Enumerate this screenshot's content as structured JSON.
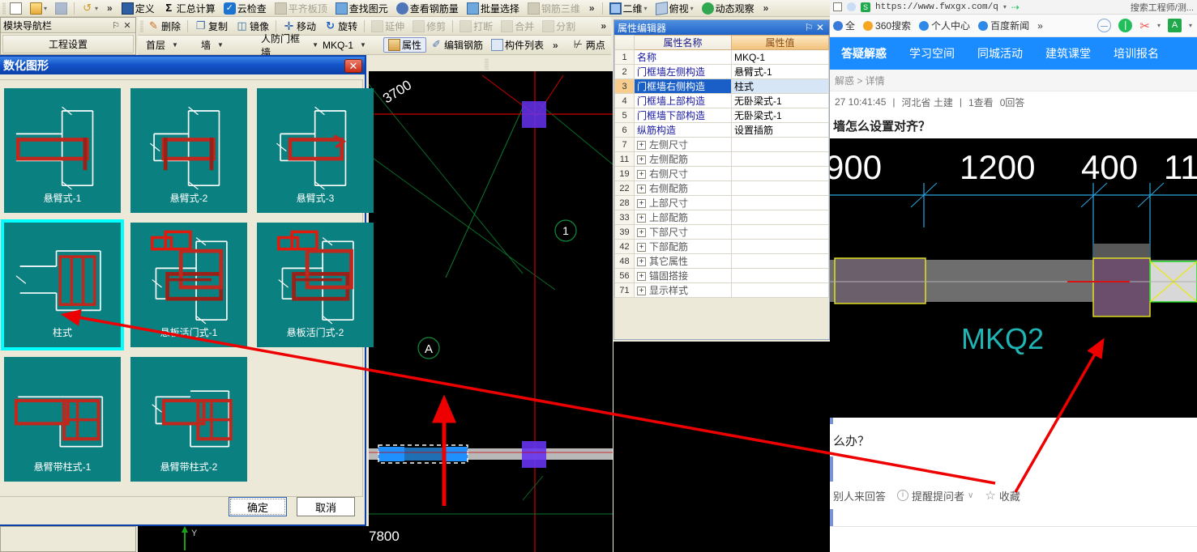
{
  "app": {
    "toolbar_row1": [
      {
        "label": "",
        "icon": "new-document-icon",
        "disabled": false
      },
      {
        "label": "",
        "icon": "open-folder-icon",
        "disabled": false
      },
      {
        "label": "",
        "icon": "save-icon",
        "disabled": true
      },
      {
        "label": "",
        "icon": "undo-icon",
        "disabled": true
      },
      {
        "label": "定义",
        "icon": "define-icon",
        "disabled": false
      },
      {
        "label": "汇总计算",
        "icon": "sigma-icon",
        "disabled": false
      },
      {
        "label": "云检查",
        "icon": "cloud-check-icon",
        "disabled": false
      },
      {
        "label": "平齐板顶",
        "icon": "align-slab-icon",
        "disabled": true
      },
      {
        "label": "查找图元",
        "icon": "binoculars-icon",
        "disabled": false
      },
      {
        "label": "查看钢筋量",
        "icon": "view-rebar-icon",
        "disabled": false
      },
      {
        "label": "批量选择",
        "icon": "batch-select-icon",
        "disabled": false
      },
      {
        "label": "钢筋三维",
        "icon": "rebar-3d-icon",
        "disabled": true
      },
      {
        "label": "二维",
        "icon": "view-2d-icon",
        "disabled": false
      },
      {
        "label": "俯视",
        "icon": "top-view-icon",
        "disabled": false
      },
      {
        "label": "动态观察",
        "icon": "dynamic-observe-icon",
        "disabled": false
      }
    ],
    "toolbar_row2": [
      {
        "label": "删除",
        "icon": "delete-icon",
        "disabled": false
      },
      {
        "label": "复制",
        "icon": "copy-icon",
        "disabled": false
      },
      {
        "label": "镜像",
        "icon": "mirror-icon",
        "disabled": false
      },
      {
        "label": "移动",
        "icon": "move-icon",
        "disabled": false
      },
      {
        "label": "旋转",
        "icon": "rotate-icon",
        "disabled": false
      },
      {
        "label": "延伸",
        "icon": "extend-icon",
        "disabled": true
      },
      {
        "label": "修剪",
        "icon": "trim-icon",
        "disabled": true
      },
      {
        "label": "打断",
        "icon": "break-icon",
        "disabled": true
      },
      {
        "label": "合并",
        "icon": "merge-icon",
        "disabled": true
      },
      {
        "label": "分割",
        "icon": "split-icon",
        "disabled": true
      }
    ],
    "toolbar_row3": [
      {
        "label": "属性",
        "icon": "property-icon",
        "selected": true
      },
      {
        "label": "编辑钢筋",
        "icon": "edit-rebar-icon",
        "selected": false
      },
      {
        "label": "构件列表",
        "icon": "component-list-icon",
        "selected": false
      },
      {
        "label": "两点",
        "icon": "two-point-icon",
        "selected": false
      }
    ],
    "overflow_label": "»",
    "module_nav": {
      "title": "模块导航栏",
      "pin": "⚐",
      "close": "✕",
      "button": "工程设置"
    },
    "combos": [
      {
        "value": "首层",
        "name": "floor-selector"
      },
      {
        "value": "墙",
        "name": "category-selector"
      },
      {
        "value": "人防门框墙",
        "name": "component-type-selector"
      },
      {
        "value": "MKQ-1",
        "name": "component-name-selector"
      }
    ]
  },
  "property_editor": {
    "title": "属性编辑器",
    "pin": "⚐",
    "close": "✕",
    "headers": {
      "index": "",
      "name": "属性名称",
      "value": "属性值"
    },
    "rows": [
      {
        "idx": "1",
        "name": "名称",
        "value": "MKQ-1",
        "group": false,
        "selected": false
      },
      {
        "idx": "2",
        "name": "门框墙左侧构造",
        "value": "悬臂式-1",
        "group": false,
        "selected": false
      },
      {
        "idx": "3",
        "name": "门框墙右侧构造",
        "value": "柱式",
        "group": false,
        "selected": true
      },
      {
        "idx": "4",
        "name": "门框墙上部构造",
        "value": "无卧梁式-1",
        "group": false,
        "selected": false
      },
      {
        "idx": "5",
        "name": "门框墙下部构造",
        "value": "无卧梁式-1",
        "group": false,
        "selected": false
      },
      {
        "idx": "6",
        "name": "纵筋构造",
        "value": "设置插筋",
        "group": false,
        "selected": false
      },
      {
        "idx": "7",
        "name": "左侧尺寸",
        "value": "",
        "group": true,
        "selected": false
      },
      {
        "idx": "11",
        "name": "左侧配筋",
        "value": "",
        "group": true,
        "selected": false
      },
      {
        "idx": "19",
        "name": "右侧尺寸",
        "value": "",
        "group": true,
        "selected": false
      },
      {
        "idx": "22",
        "name": "右侧配筋",
        "value": "",
        "group": true,
        "selected": false
      },
      {
        "idx": "28",
        "name": "上部尺寸",
        "value": "",
        "group": true,
        "selected": false
      },
      {
        "idx": "33",
        "name": "上部配筋",
        "value": "",
        "group": true,
        "selected": false
      },
      {
        "idx": "39",
        "name": "下部尺寸",
        "value": "",
        "group": true,
        "selected": false
      },
      {
        "idx": "42",
        "name": "下部配筋",
        "value": "",
        "group": true,
        "selected": false
      },
      {
        "idx": "48",
        "name": "其它属性",
        "value": "",
        "group": true,
        "selected": false
      },
      {
        "idx": "56",
        "name": "锚固搭接",
        "value": "",
        "group": true,
        "selected": false
      },
      {
        "idx": "71",
        "name": "显示样式",
        "value": "",
        "group": true,
        "selected": false
      }
    ],
    "expand_glyph": "+"
  },
  "dialog": {
    "title": "数化图形",
    "close": "✕",
    "tiles": [
      {
        "caption": "悬臂式-1",
        "shape": "cantilever1",
        "selected": false
      },
      {
        "caption": "悬臂式-2",
        "shape": "cantilever2",
        "selected": false
      },
      {
        "caption": "悬臂式-3",
        "shape": "cantilever3",
        "selected": false
      },
      {
        "caption": "柱式",
        "shape": "column",
        "selected": true
      },
      {
        "caption": "悬板活门式-1",
        "shape": "flap1",
        "selected": false
      },
      {
        "caption": "悬板活门式-2",
        "shape": "flap2",
        "selected": false
      },
      {
        "caption": "悬臂带柱式-1",
        "shape": "cantcol1",
        "selected": false
      },
      {
        "caption": "悬臂带柱式-2",
        "shape": "cantcol2",
        "selected": false
      }
    ],
    "ok": "确定",
    "cancel": "取消"
  },
  "cad": {
    "labels": [
      "3700",
      "7800"
    ],
    "axis_bubbles": [
      "1",
      "A"
    ]
  },
  "browser": {
    "url": "https://www.fwxgx.com/q",
    "url_right": "搜索工程师/测...",
    "bookmarks": [
      {
        "label": "全",
        "icon": "shield-icon",
        "color": "#3a7ad9"
      },
      {
        "label": "360搜索",
        "icon": "search-360-icon",
        "color": "#f5a623"
      },
      {
        "label": "个人中心",
        "icon": "baidu-paw-icon",
        "color": "#2e8ae6"
      },
      {
        "label": "百度新闻",
        "icon": "baidu-paw-icon",
        "color": "#2e8ae6"
      },
      {
        "label": "»",
        "icon": "more-bookmarks-icon",
        "color": "transparent"
      }
    ],
    "toolbar_right": [
      {
        "icon": "block-icon"
      },
      {
        "icon": "pause-icon"
      },
      {
        "icon": "scissors-icon"
      },
      {
        "icon": "translate-icon"
      }
    ],
    "nav": [
      {
        "label": "答疑解惑",
        "active": true
      },
      {
        "label": "学习空间",
        "active": false
      },
      {
        "label": "同城活动",
        "active": false
      },
      {
        "label": "建筑课堂",
        "active": false
      },
      {
        "label": "培训报名",
        "active": false
      }
    ],
    "breadcrumb": "解惑 > 详情",
    "meta": {
      "time": "27 10:41:45",
      "sep1": "|",
      "region": "河北省 土建",
      "sep2": "|",
      "views": "1查看",
      "answers": "0回答"
    },
    "question_title": "墙怎么设置对齐？",
    "question_body": "么办？",
    "image": {
      "dims": [
        "900",
        "1200",
        "400",
        "11"
      ],
      "label": "MKQ2"
    },
    "actions": [
      {
        "label": "别人来回答",
        "icon": "none"
      },
      {
        "label": "提醒提问者",
        "icon": "info-icon",
        "caret": "∨"
      },
      {
        "label": "收藏",
        "icon": "star-icon"
      }
    ]
  }
}
